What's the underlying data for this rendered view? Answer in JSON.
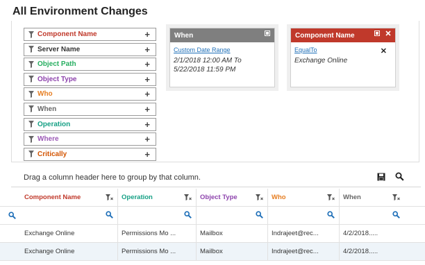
{
  "page": {
    "title": "All Environment Changes"
  },
  "filters": [
    {
      "label": "Component Name",
      "color": "#c0392b"
    },
    {
      "label": "Server Name",
      "color": "#333333"
    },
    {
      "label": "Object Path",
      "color": "#27ae60"
    },
    {
      "label": "Object Type",
      "color": "#8e44ad"
    },
    {
      "label": "Who",
      "color": "#e67e22"
    },
    {
      "label": "When",
      "color": "#666666"
    },
    {
      "label": "Operation",
      "color": "#16a085"
    },
    {
      "label": "Where",
      "color": "#9b59b6"
    },
    {
      "label": "Critically",
      "color": "#d35400"
    }
  ],
  "cards": {
    "when": {
      "title": "When",
      "link": "Custom Date Range",
      "text_line1": "2/1/2018 12:00 AM To",
      "text_line2": "5/22/2018 11:59 PM"
    },
    "component": {
      "title": "Component Name",
      "link": "EqualTo",
      "text": "Exchange Online"
    }
  },
  "grid": {
    "group_hint": "Drag a column header here to group by that column.",
    "columns": [
      {
        "label": "Component Name",
        "color": "#c0392b"
      },
      {
        "label": "Operation",
        "color": "#16a085"
      },
      {
        "label": "Object Type",
        "color": "#8e44ad"
      },
      {
        "label": "Who",
        "color": "#e67e22"
      },
      {
        "label": "When",
        "color": "#666666"
      }
    ],
    "rows": [
      [
        "Exchange Online",
        "Permissions Mo ...",
        "Mailbox",
        "Indrajeet@rec...",
        "4/2/2018....."
      ],
      [
        "Exchange Online",
        "Permissions Mo ...",
        "Mailbox",
        "Indrajeet@rec...",
        "4/2/2018....."
      ]
    ]
  },
  "icons": {
    "filter": "funnel-icon",
    "add": "plus-icon",
    "save": "save-icon",
    "search": "search-icon",
    "close": "close-icon",
    "minimize": "minimize-icon"
  }
}
